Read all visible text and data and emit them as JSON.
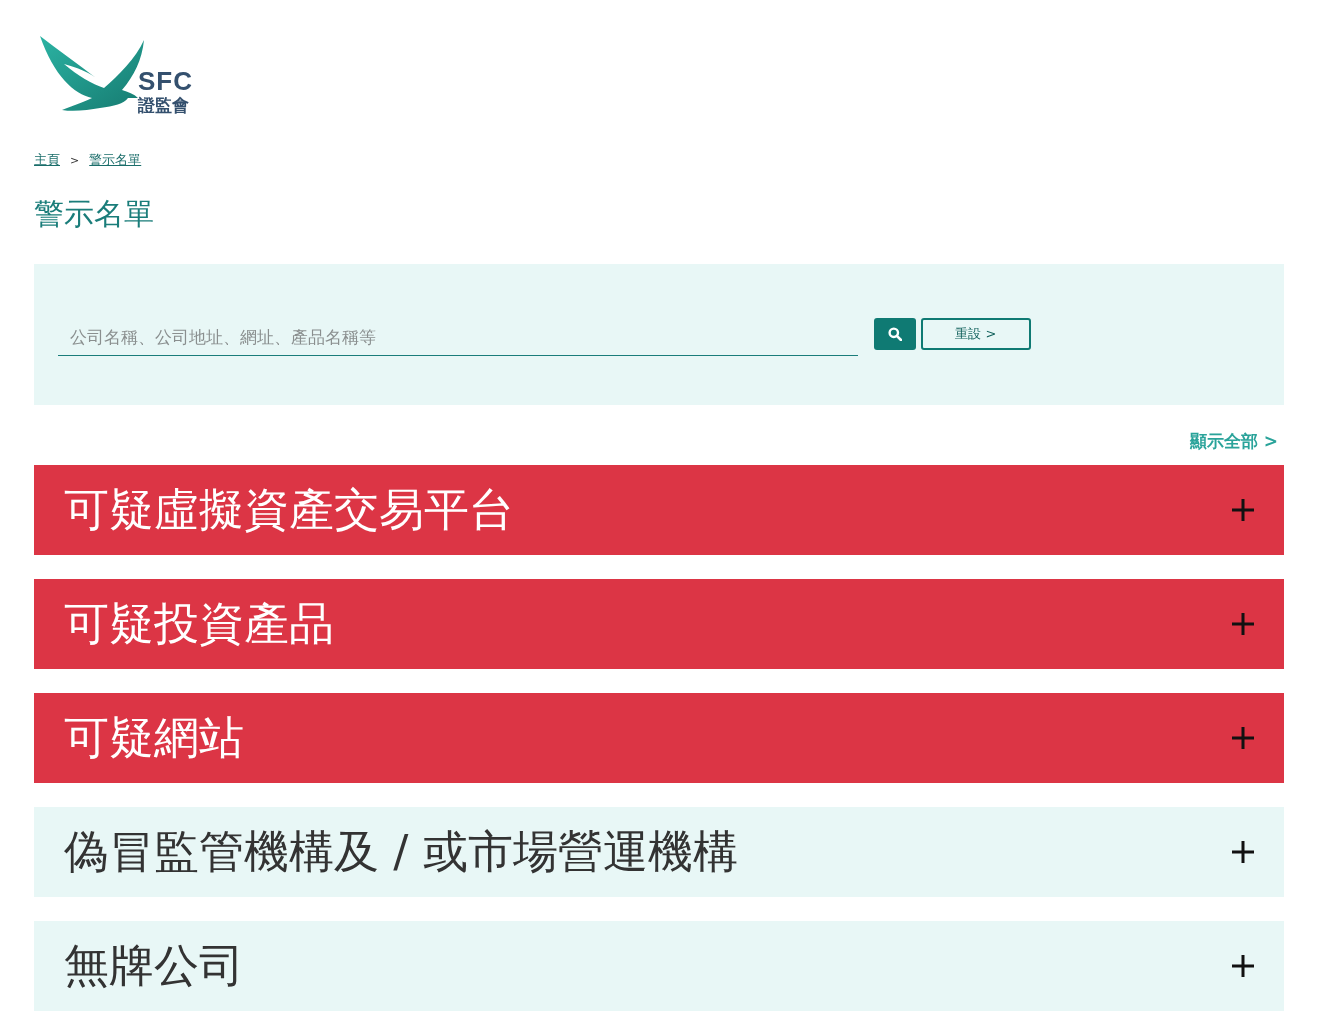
{
  "logo": {
    "abbr": "SFC",
    "name": "證監會"
  },
  "breadcrumb": [
    {
      "label": "主頁"
    },
    {
      "label": "警示名單"
    }
  ],
  "breadcrumb_separator": ">",
  "title": "警示名單",
  "search": {
    "placeholder": "公司名稱、公司地址、網址、產品名稱等",
    "reset_label": "重設 >"
  },
  "show_all": "顯示全部 >",
  "sections": [
    {
      "label": "可疑虛擬資產交易平台",
      "kind": "alert",
      "expanded": false
    },
    {
      "label": "可疑投資產品",
      "kind": "alert",
      "expanded": false
    },
    {
      "label": "可疑網站",
      "kind": "alert",
      "expanded": false
    },
    {
      "label": "偽冒監管機構及 / 或市場營運機構",
      "kind": "info",
      "expanded": false
    },
    {
      "label": "無牌公司",
      "kind": "info",
      "expanded": false
    }
  ]
}
